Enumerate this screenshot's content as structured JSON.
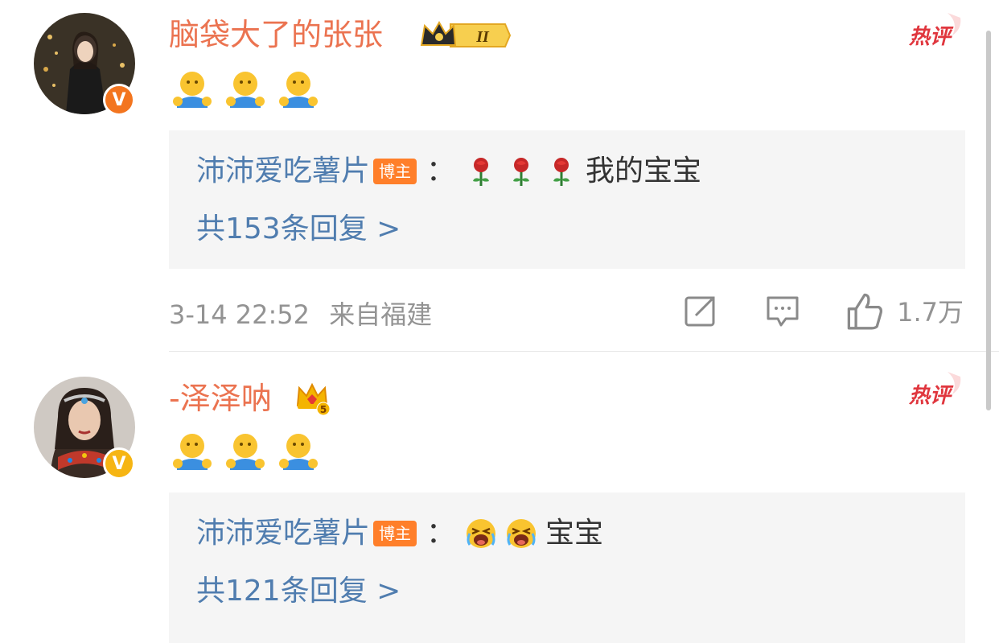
{
  "comments": [
    {
      "username": "脑袋大了的张张",
      "vip_level": "II",
      "hot_label": "热评",
      "emoji_count": 3,
      "reply": {
        "author": "沛沛爱吃薯片",
        "author_tag": "博主",
        "colon": "：",
        "text": "我的宝宝",
        "count_label": "共153条回复 >"
      },
      "time": "3-14 22:52",
      "location": "来自福建",
      "likes": "1.7万"
    },
    {
      "username": "-泽泽呐",
      "vip_level": "5",
      "hot_label": "热评",
      "emoji_count": 3,
      "reply": {
        "author": "沛沛爱吃薯片",
        "author_tag": "博主",
        "colon": "：",
        "text": "宝宝",
        "count_label": "共121条回复 >"
      }
    }
  ],
  "colors": {
    "username": "#eb7350",
    "link_blue": "#507daf",
    "hot_red": "#e0363e",
    "verified_orange": "#f3751f",
    "verified_yellow": "#f6b513",
    "blogger_tag": "#ff7f2a"
  },
  "icons": {
    "reply_emoji_1": "rose-icon",
    "reply_emoji_2": "crying-face-icon",
    "comment_emoji": "hug-emoji-icon",
    "repost": "repost-icon",
    "comment": "comment-icon",
    "like": "thumbs-up-icon"
  }
}
